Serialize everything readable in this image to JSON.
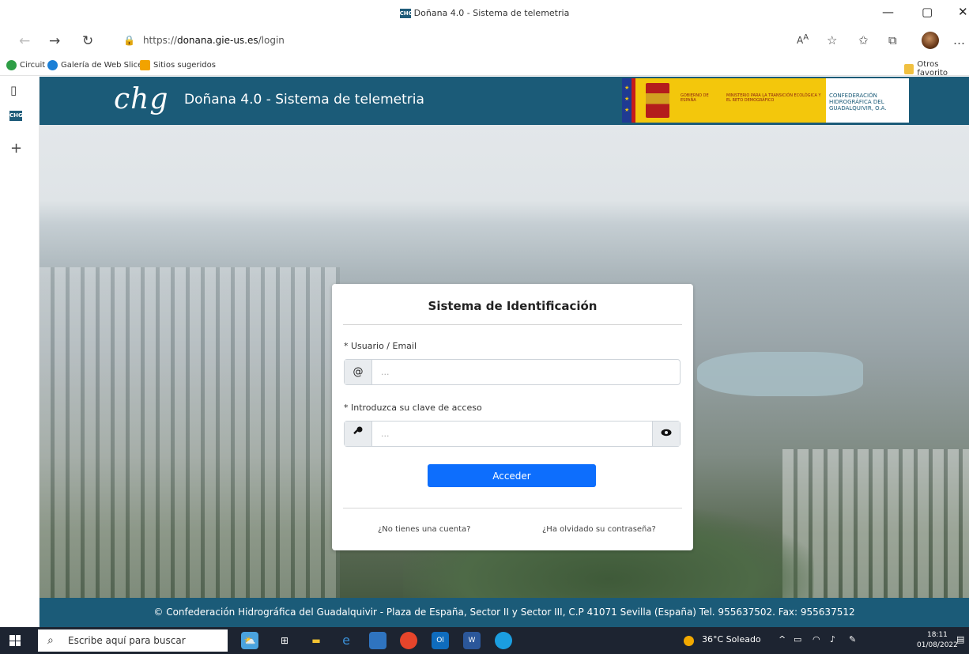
{
  "window": {
    "title": "Doñana 4.0 - Sistema de telemetria",
    "tab_icon_text": "CHG",
    "controls": {
      "minimize": "—",
      "maximize": "▢",
      "close": "✕"
    }
  },
  "browser": {
    "url_prefix": "https://",
    "url_host": "donana.gie-us.es",
    "url_path": "/login",
    "favorites": [
      {
        "label": "Circuit",
        "color": "#2e9e46"
      },
      {
        "label": "Galería de Web Slice",
        "color": "#1b7fd6"
      },
      {
        "label": "Sitios sugeridos",
        "color": "#f2a300"
      }
    ],
    "other_favorites": "Otros favorito",
    "more": "…"
  },
  "site": {
    "logo": "chg",
    "title": "Doñana 4.0 - Sistema de telemetria",
    "gov_text_1": "GOBIERNO DE ESPAÑA",
    "gov_text_2": "MINISTERIO PARA LA TRANSICIÓN ECOLÓGICA Y EL RETO DEMOGRÁFICO",
    "chg_full": "CONFEDERACIÓN HIDROGRÁFICA DEL GUADALQUIVIR, O.A.",
    "footer": "© Confederación Hidrográfica del Guadalquivir - Plaza de España, Sector II y Sector III, C.P 41071 Sevilla (España) Tel. 955637502. Fax: 955637512"
  },
  "login": {
    "title": "Sistema de Identificación",
    "user_label": "* Usuario / Email",
    "user_placeholder": "...",
    "user_icon": "@",
    "password_label": "* Introduzca su clave de acceso",
    "password_placeholder": "...",
    "submit": "Acceder",
    "no_account": "¿No tienes una cuenta?",
    "forgot": "¿Ha olvidado su contraseña?"
  },
  "taskbar": {
    "search_placeholder": "Escribe aquí para buscar",
    "weather": "36°C  Soleado",
    "time": "18:11",
    "date": "01/08/2022"
  },
  "colors": {
    "header_bg": "#1b5b78",
    "primary_button": "#0d6efd",
    "gov_yellow": "#f3c70c"
  }
}
